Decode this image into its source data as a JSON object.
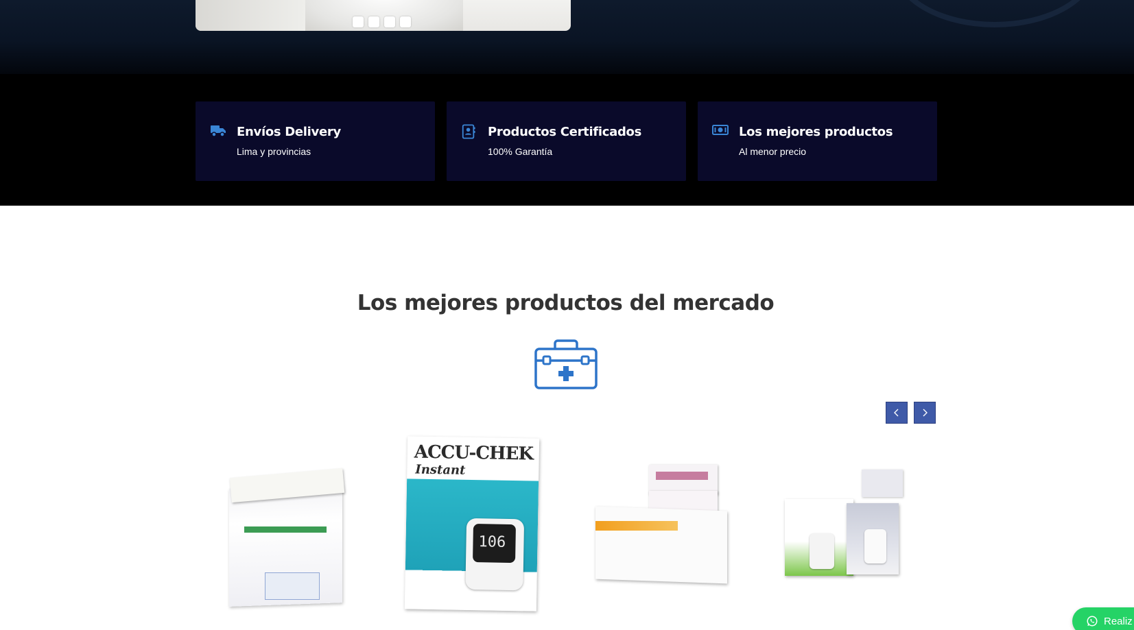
{
  "hero": {
    "slider_dots": [
      "slide-1",
      "slide-2",
      "slide-3",
      "slide-4"
    ]
  },
  "features": [
    {
      "icon": "truck-icon",
      "title": "Envíos Delivery",
      "subtitle": "Lima y provincias"
    },
    {
      "icon": "certificate-icon",
      "title": "Productos Certificados",
      "subtitle": "100% Garantía"
    },
    {
      "icon": "money-icon",
      "title": "Los mejores productos",
      "subtitle": "Al menor precio"
    }
  ],
  "products_section": {
    "title": "Los mejores productos del mercado",
    "icon": "medical-kit-icon",
    "nav": {
      "prev": "chevron-left-icon",
      "next": "chevron-right-icon"
    },
    "products": [
      {
        "image": "tongue-depressor-box"
      },
      {
        "image": "accu-chek-instant-box",
        "brand": "ACCU-CHEK",
        "model": "Instant",
        "reading": "106"
      },
      {
        "image": "hcg-rapid-test-box"
      },
      {
        "image": "vivachek-glucometer-box"
      }
    ]
  },
  "whatsapp": {
    "label": "Realiz",
    "icon": "whatsapp-icon"
  },
  "colors": {
    "feature_bg": "#0a0a2a",
    "accent_blue": "#3a86d6",
    "nav_btn": "#3f5aa8",
    "whatsapp": "#25d366",
    "title_text": "#333333"
  }
}
